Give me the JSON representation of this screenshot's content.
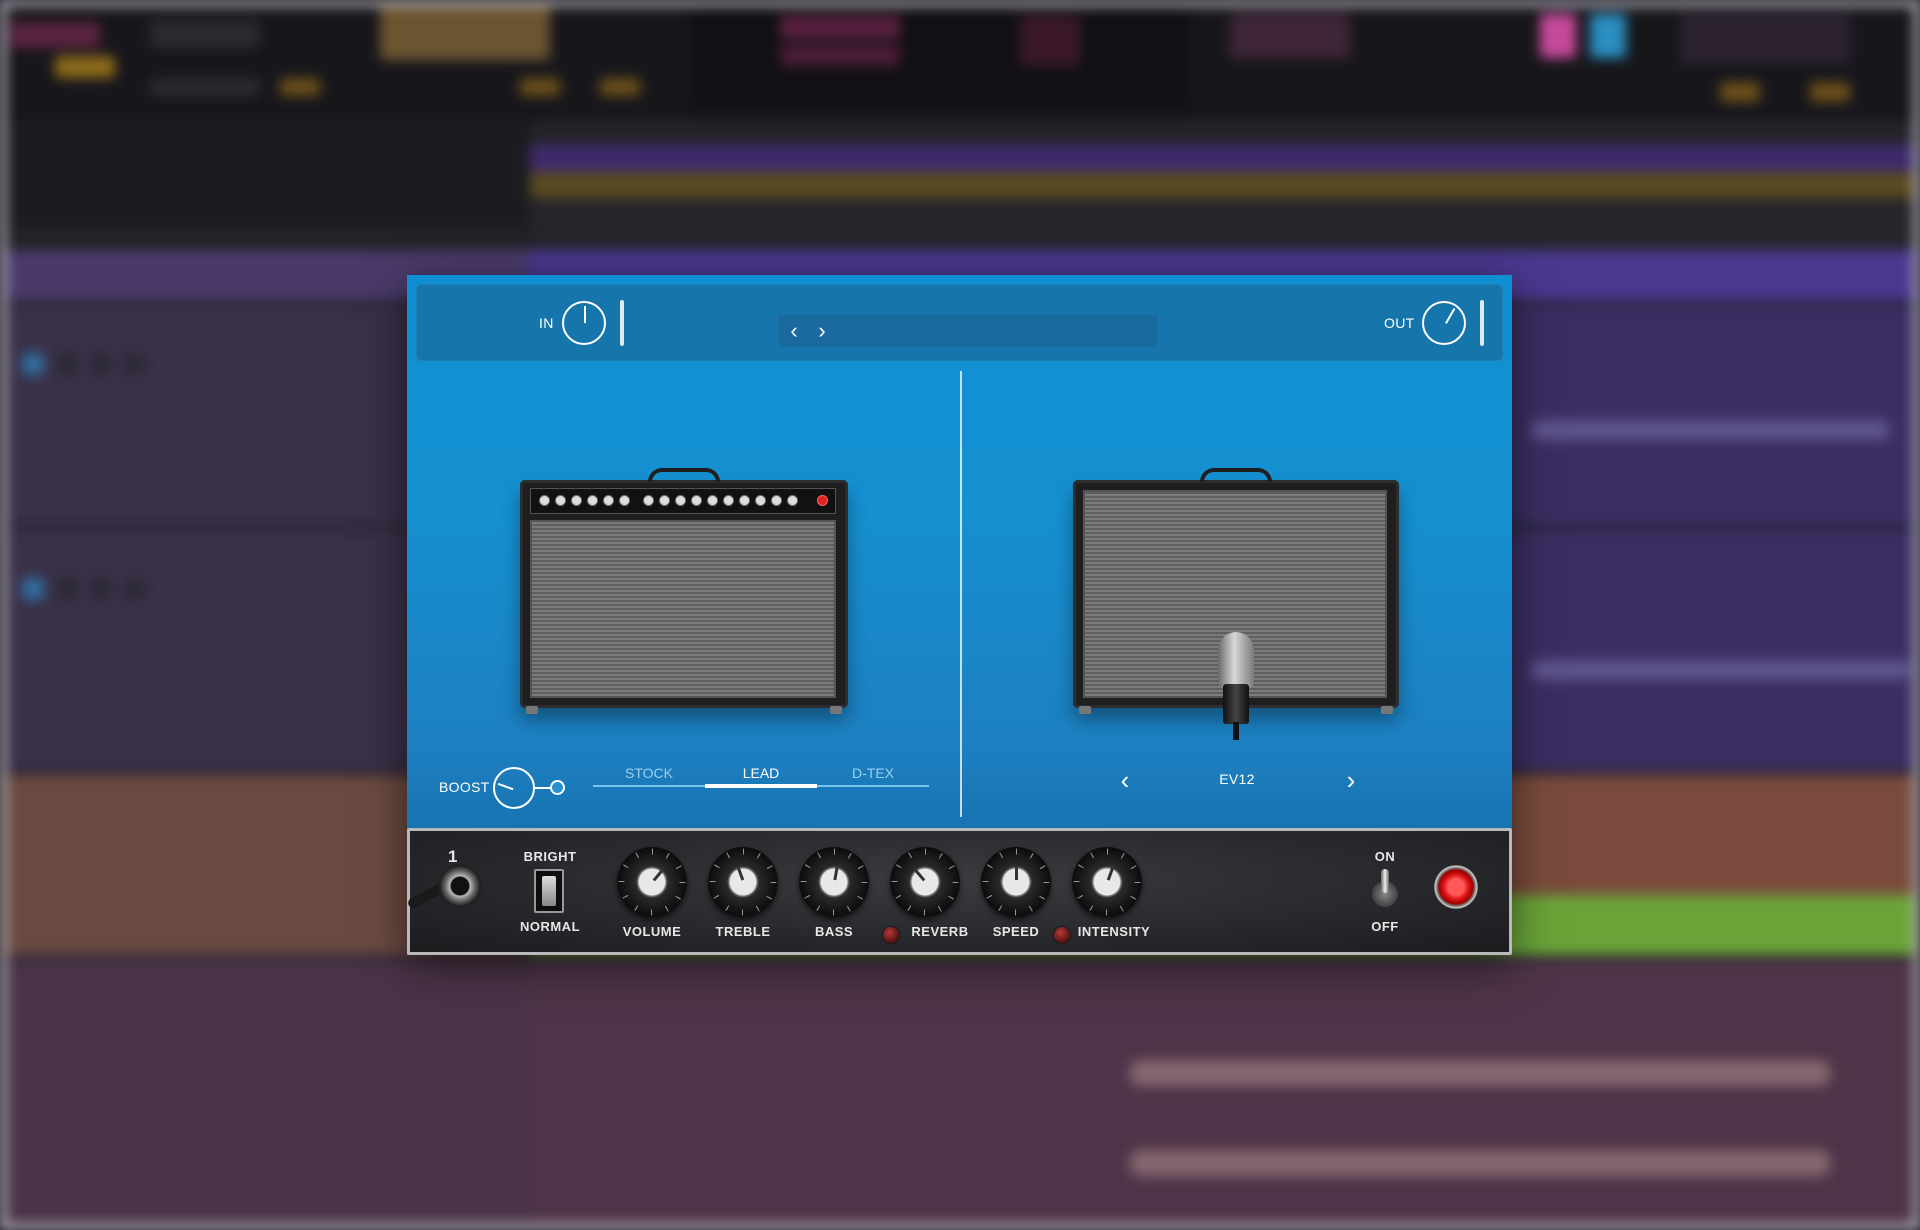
{
  "io": {
    "in_label": "IN",
    "out_label": "OUT"
  },
  "preset_nav": {
    "prev_symbol": "‹",
    "next_symbol": "›",
    "name": ""
  },
  "boost": {
    "label": "BOOST"
  },
  "amp_tabs": [
    {
      "label": "STOCK",
      "active": false
    },
    {
      "label": "LEAD",
      "active": true
    },
    {
      "label": "D-TEX",
      "active": false
    }
  ],
  "cabinet": {
    "name": "EV12",
    "prev_symbol": "‹",
    "next_symbol": "›"
  },
  "controls": {
    "input_number": "1",
    "bright_label": "BRIGHT",
    "normal_label": "NORMAL",
    "knobs": [
      {
        "label": "VOLUME"
      },
      {
        "label": "TREBLE"
      },
      {
        "label": "BASS"
      },
      {
        "label": "REVERB"
      },
      {
        "label": "SPEED"
      },
      {
        "label": "INTENSITY"
      }
    ],
    "on_label": "ON",
    "off_label": "OFF"
  },
  "colors": {
    "plugin_blue": "#1590d0",
    "topbar_blue": "#1676ab",
    "pilot_red": "#e11818",
    "daw_purple": "#3a3048"
  }
}
